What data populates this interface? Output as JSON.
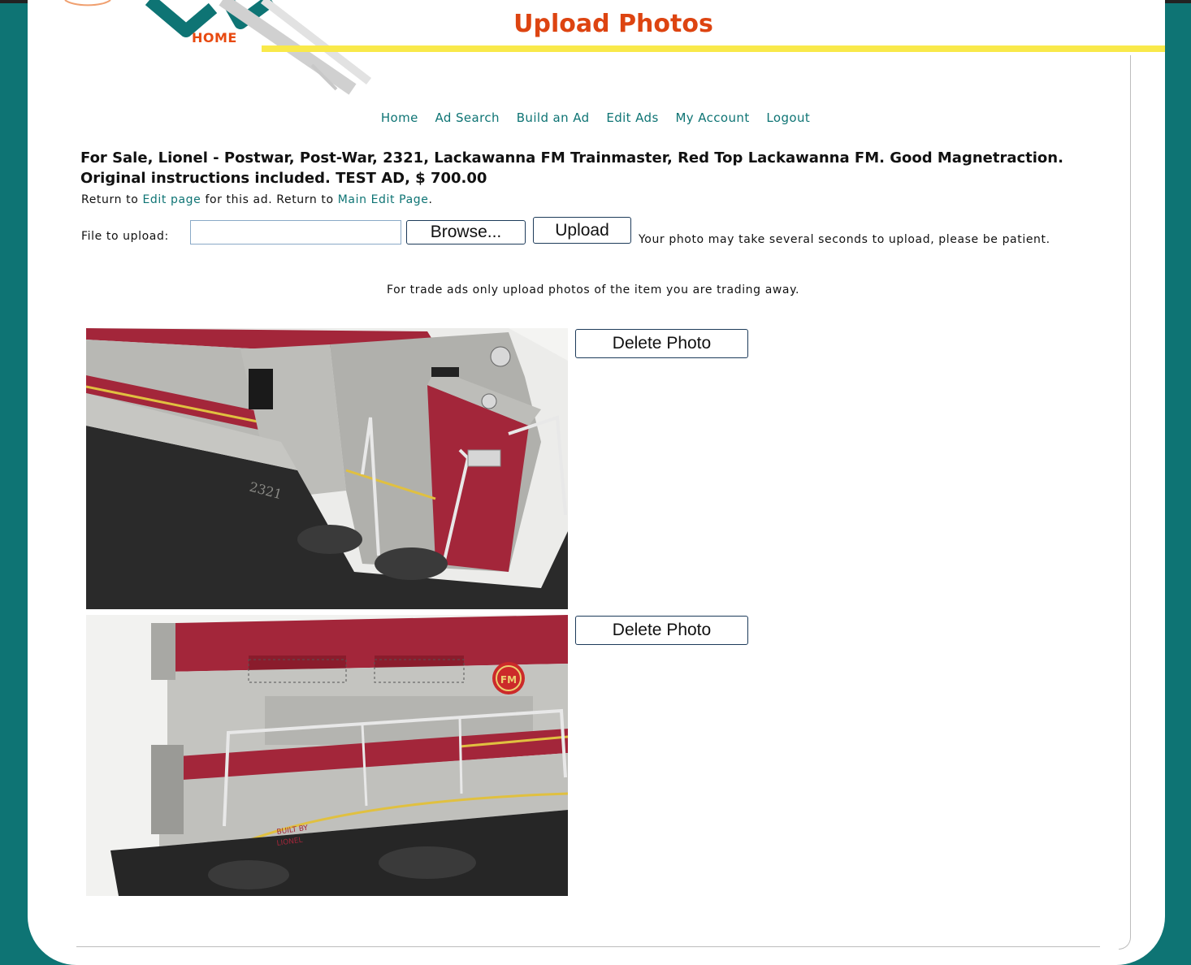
{
  "header": {
    "home_label": "HOME",
    "title": "Upload Photos"
  },
  "nav": {
    "items": [
      "Home",
      "Ad Search",
      "Build an Ad",
      "Edit Ads",
      "My Account",
      "Logout"
    ]
  },
  "ad": {
    "title": "For Sale, Lionel - Postwar, Post-War, 2321, Lackawanna FM Trainmaster, Red Top Lackawanna FM. Good Magnetraction. Original instructions included. TEST AD, $ 700.00"
  },
  "return_line": {
    "prefix": "Return to",
    "edit_page_link": "Edit page",
    "middle": "for this ad. Return to",
    "main_edit_link": "Main Edit Page",
    "suffix": "."
  },
  "upload": {
    "label": "File to upload:",
    "file_value": "",
    "browse_label": "Browse...",
    "upload_label": "Upload",
    "patience_text": "Your photo may take several seconds to upload, please be patient."
  },
  "trade_note": "For trade ads only upload photos of the item you are trading away.",
  "photos": [
    {
      "delete_label": "Delete Photo",
      "number_text": "2321"
    },
    {
      "delete_label": "Delete Photo",
      "builder_line1": "BUILT BY",
      "builder_line2": "LIONEL",
      "emblem": "FM"
    }
  ],
  "colors": {
    "background_teal": "#0e7474",
    "title_orange": "#dd4411",
    "link_teal": "#0e7474",
    "header_bar_yellow": "#f9e94a",
    "train_red": "#a3263a",
    "train_gray": "#b8b8b4"
  }
}
